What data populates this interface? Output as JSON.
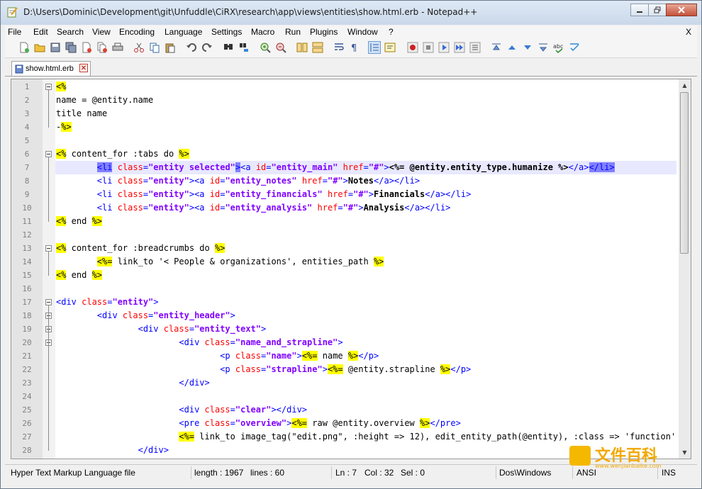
{
  "window": {
    "title": "D:\\Users\\Dominic\\Development\\git\\Unfuddle\\CiRX\\research\\app\\views\\entities\\show.html.erb - Notepad++",
    "controls": [
      "minimize",
      "maximize",
      "close"
    ]
  },
  "menubar": {
    "items": [
      "File",
      "Edit",
      "Search",
      "View",
      "Encoding",
      "Language",
      "Settings",
      "Macro",
      "Run",
      "Plugins",
      "Window",
      "?"
    ],
    "close_label": "X"
  },
  "toolbar": {
    "icons": [
      "new-file-icon",
      "open-file-icon",
      "save-icon",
      "save-all-icon",
      "close-icon",
      "close-all-icon",
      "print-icon",
      "cut-icon",
      "copy-icon",
      "paste-icon",
      "undo-icon",
      "redo-icon",
      "find-icon",
      "replace-icon",
      "zoom-in-icon",
      "zoom-out-icon",
      "sync-vertical-icon",
      "sync-horizontal-icon",
      "word-wrap-icon",
      "show-all-chars-icon",
      "indent-guide-icon",
      "user-lang-icon",
      "record-macro-icon",
      "stop-macro-icon",
      "play-macro-icon",
      "run-macro-multiple-icon",
      "save-macro-icon",
      "trim-icon",
      "move-up-icon",
      "move-down-icon",
      "sort-icon",
      "spellcheck-icon",
      "check-icon"
    ]
  },
  "tabs": [
    {
      "label": "show.html.erb",
      "active": true
    }
  ],
  "editor": {
    "current_line": 7,
    "lines": [
      {
        "n": "1",
        "segs": [
          [
            "erb",
            "<%"
          ]
        ]
      },
      {
        "n": "2",
        "segs": [
          [
            "txt",
            "name = @entity.name"
          ]
        ]
      },
      {
        "n": "3",
        "segs": [
          [
            "txt",
            "title name"
          ]
        ]
      },
      {
        "n": "4",
        "segs": [
          [
            "txt",
            "-"
          ],
          [
            "erb",
            "%>"
          ]
        ]
      },
      {
        "n": "5",
        "segs": []
      },
      {
        "n": "6",
        "segs": [
          [
            "erb",
            "<%"
          ],
          [
            "txt",
            " content_for :tabs do "
          ],
          [
            "erb",
            "%>"
          ]
        ]
      },
      {
        "n": "7",
        "segs": [
          [
            "ind",
            "        "
          ],
          [
            "sel-tag",
            "<li"
          ],
          [
            "txt",
            " "
          ],
          [
            "attr",
            "class"
          ],
          [
            "tag",
            "="
          ],
          [
            "val",
            "\"entity selected\""
          ],
          [
            "sel-tag",
            ">"
          ],
          [
            "tag",
            "<a "
          ],
          [
            "attr",
            "id"
          ],
          [
            "tag",
            "="
          ],
          [
            "val",
            "\"entity_main\""
          ],
          [
            "txt",
            " "
          ],
          [
            "attr",
            "href"
          ],
          [
            "tag",
            "="
          ],
          [
            "val",
            "\"#\""
          ],
          [
            "tag",
            ">"
          ],
          [
            "bold",
            "<%= @entity.entity_type.humanize %>"
          ],
          [
            "tag",
            "</a>"
          ],
          [
            "sel-tag",
            "</li>"
          ]
        ]
      },
      {
        "n": "8",
        "segs": [
          [
            "ind",
            "        "
          ],
          [
            "tag",
            "<li "
          ],
          [
            "attr",
            "class"
          ],
          [
            "tag",
            "="
          ],
          [
            "val",
            "\"entity\""
          ],
          [
            "tag",
            "><a "
          ],
          [
            "attr",
            "id"
          ],
          [
            "tag",
            "="
          ],
          [
            "val",
            "\"entity_notes\""
          ],
          [
            "txt",
            " "
          ],
          [
            "attr",
            "href"
          ],
          [
            "tag",
            "="
          ],
          [
            "val",
            "\"#\""
          ],
          [
            "tag",
            ">"
          ],
          [
            "bold",
            "Notes"
          ],
          [
            "tag",
            "</a></li>"
          ]
        ]
      },
      {
        "n": "9",
        "segs": [
          [
            "ind",
            "        "
          ],
          [
            "tag",
            "<li "
          ],
          [
            "attr",
            "class"
          ],
          [
            "tag",
            "="
          ],
          [
            "val",
            "\"entity\""
          ],
          [
            "tag",
            "><a "
          ],
          [
            "attr",
            "id"
          ],
          [
            "tag",
            "="
          ],
          [
            "val",
            "\"entity_financials\""
          ],
          [
            "txt",
            " "
          ],
          [
            "attr",
            "href"
          ],
          [
            "tag",
            "="
          ],
          [
            "val",
            "\"#\""
          ],
          [
            "tag",
            ">"
          ],
          [
            "bold",
            "Financials"
          ],
          [
            "tag",
            "</a></li>"
          ]
        ]
      },
      {
        "n": "10",
        "segs": [
          [
            "ind",
            "        "
          ],
          [
            "tag",
            "<li "
          ],
          [
            "attr",
            "class"
          ],
          [
            "tag",
            "="
          ],
          [
            "val",
            "\"entity\""
          ],
          [
            "tag",
            "><a "
          ],
          [
            "attr",
            "id"
          ],
          [
            "tag",
            "="
          ],
          [
            "val",
            "\"entity_analysis\""
          ],
          [
            "txt",
            " "
          ],
          [
            "attr",
            "href"
          ],
          [
            "tag",
            "="
          ],
          [
            "val",
            "\"#\""
          ],
          [
            "tag",
            ">"
          ],
          [
            "bold",
            "Analysis"
          ],
          [
            "tag",
            "</a></li>"
          ]
        ]
      },
      {
        "n": "11",
        "segs": [
          [
            "erb",
            "<%"
          ],
          [
            "txt",
            " end "
          ],
          [
            "erb",
            "%>"
          ]
        ]
      },
      {
        "n": "12",
        "segs": []
      },
      {
        "n": "13",
        "segs": [
          [
            "erb",
            "<%"
          ],
          [
            "txt",
            " content_for :breadcrumbs do "
          ],
          [
            "erb",
            "%>"
          ]
        ]
      },
      {
        "n": "14",
        "segs": [
          [
            "ind",
            "        "
          ],
          [
            "erb",
            "<%="
          ],
          [
            "txt",
            " link_to '< People & organizations', entities_path "
          ],
          [
            "erb",
            "%>"
          ]
        ]
      },
      {
        "n": "15",
        "segs": [
          [
            "erb",
            "<%"
          ],
          [
            "txt",
            " end "
          ],
          [
            "erb",
            "%>"
          ]
        ]
      },
      {
        "n": "16",
        "segs": []
      },
      {
        "n": "17",
        "segs": [
          [
            "tag",
            "<div "
          ],
          [
            "attr",
            "class"
          ],
          [
            "tag",
            "="
          ],
          [
            "val",
            "\"entity\""
          ],
          [
            "tag",
            ">"
          ]
        ]
      },
      {
        "n": "18",
        "segs": [
          [
            "ind",
            "        "
          ],
          [
            "tag",
            "<div "
          ],
          [
            "attr",
            "class"
          ],
          [
            "tag",
            "="
          ],
          [
            "val",
            "\"entity_header\""
          ],
          [
            "tag",
            ">"
          ]
        ]
      },
      {
        "n": "19",
        "segs": [
          [
            "ind",
            "                "
          ],
          [
            "tag",
            "<div "
          ],
          [
            "attr",
            "class"
          ],
          [
            "tag",
            "="
          ],
          [
            "val",
            "\"entity_text\""
          ],
          [
            "tag",
            ">"
          ]
        ]
      },
      {
        "n": "20",
        "segs": [
          [
            "ind",
            "                        "
          ],
          [
            "tag",
            "<div "
          ],
          [
            "attr",
            "class"
          ],
          [
            "tag",
            "="
          ],
          [
            "val",
            "\"name_and_strapline\""
          ],
          [
            "tag",
            ">"
          ]
        ]
      },
      {
        "n": "21",
        "segs": [
          [
            "ind",
            "                                "
          ],
          [
            "tag",
            "<p "
          ],
          [
            "attr",
            "class"
          ],
          [
            "tag",
            "="
          ],
          [
            "val",
            "\"name\""
          ],
          [
            "tag",
            ">"
          ],
          [
            "erb",
            "<%="
          ],
          [
            "txt",
            " name "
          ],
          [
            "erb",
            "%>"
          ],
          [
            "tag",
            "</p>"
          ]
        ]
      },
      {
        "n": "22",
        "segs": [
          [
            "ind",
            "                                "
          ],
          [
            "tag",
            "<p "
          ],
          [
            "attr",
            "class"
          ],
          [
            "tag",
            "="
          ],
          [
            "val",
            "\"strapline\""
          ],
          [
            "tag",
            ">"
          ],
          [
            "erb",
            "<%="
          ],
          [
            "txt",
            " @entity.strapline "
          ],
          [
            "erb",
            "%>"
          ],
          [
            "tag",
            "</p>"
          ]
        ]
      },
      {
        "n": "23",
        "segs": [
          [
            "ind",
            "                        "
          ],
          [
            "tag",
            "</div>"
          ]
        ]
      },
      {
        "n": "24",
        "segs": []
      },
      {
        "n": "25",
        "segs": [
          [
            "ind",
            "                        "
          ],
          [
            "tag",
            "<div "
          ],
          [
            "attr",
            "class"
          ],
          [
            "tag",
            "="
          ],
          [
            "val",
            "\"clear\""
          ],
          [
            "tag",
            "></div>"
          ]
        ]
      },
      {
        "n": "26",
        "segs": [
          [
            "ind",
            "                        "
          ],
          [
            "tag",
            "<pre "
          ],
          [
            "attr",
            "class"
          ],
          [
            "tag",
            "="
          ],
          [
            "val",
            "\"overview\""
          ],
          [
            "tag",
            ">"
          ],
          [
            "erb",
            "<%="
          ],
          [
            "txt",
            " raw @entity.overview "
          ],
          [
            "erb",
            "%>"
          ],
          [
            "tag",
            "</pre>"
          ]
        ]
      },
      {
        "n": "27",
        "segs": [
          [
            "ind",
            "                        "
          ],
          [
            "erb",
            "<%="
          ],
          [
            "txt",
            " link_to image_tag(\"edit.png\", :height => 12), edit_entity_path(@entity), :class => 'function' "
          ],
          [
            "erb",
            "%>"
          ]
        ]
      },
      {
        "n": "28",
        "segs": [
          [
            "ind",
            "                "
          ],
          [
            "tag",
            "</div>"
          ]
        ]
      }
    ]
  },
  "statusbar": {
    "file_type": "Hyper Text Markup Language file",
    "length": "length : 1967",
    "lines": "lines : 60",
    "ln": "Ln : 7",
    "col": "Col : 32",
    "sel": "Sel : 0",
    "eol": "Dos\\Windows",
    "encoding": "ANSI",
    "mode": "INS"
  },
  "watermark": {
    "text": "文件百科",
    "sub": "www.wenjianbaike.com",
    "color": "#f2a900"
  }
}
